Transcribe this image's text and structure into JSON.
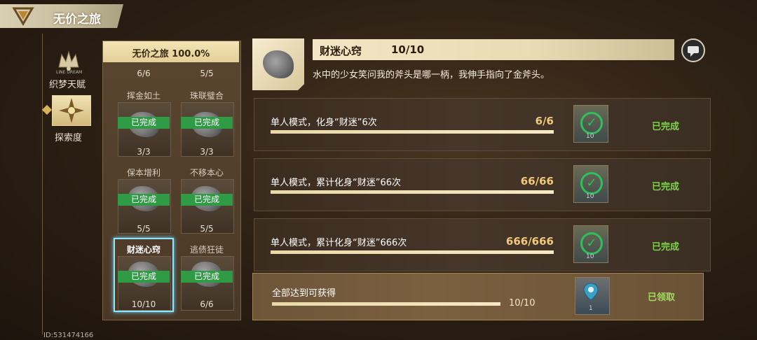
{
  "header": {
    "title": "无价之旅",
    "back_icon": "back-arrow-icon"
  },
  "sidebar": {
    "items": [
      {
        "label": "织梦天赋",
        "icon": "crown-icon",
        "sub": "LINE DREAM"
      },
      {
        "label": "探索度",
        "icon": "compass-star-icon",
        "selected": true
      }
    ],
    "user_id": "ID:531474166"
  },
  "list": {
    "header": "无价之旅 100.0%",
    "top_counts": [
      "6/6",
      "5/5"
    ],
    "cards": [
      {
        "title": "挥金如土",
        "status": "已完成",
        "count": "3/3"
      },
      {
        "title": "珠联璧合",
        "status": "已完成",
        "count": "3/3"
      },
      {
        "title": "保本增利",
        "status": "已完成",
        "count": "5/5"
      },
      {
        "title": "不移本心",
        "status": "已完成",
        "count": "5/5"
      },
      {
        "title": "财迷心窍",
        "status": "已完成",
        "count": "10/10"
      },
      {
        "title": "逃债狂徒",
        "status": "已完成",
        "count": "6/6"
      }
    ]
  },
  "detail": {
    "title": "财迷心窍",
    "progress": "10/10",
    "description": "水中的少女笑问我的斧头是哪一柄，我伸手指向了金斧头。",
    "chat_icon": "chat-bubble-icon"
  },
  "tasks": [
    {
      "label": "单人模式，化身“财迷”6次",
      "count": "6/6",
      "progress": 1.0,
      "reward_num": "10",
      "status": "已完成"
    },
    {
      "label": "单人模式，累计化身“财迷”66次",
      "count": "66/66",
      "progress": 1.0,
      "reward_num": "10",
      "status": "已完成"
    },
    {
      "label": "单人模式，累计化身“财迷”666次",
      "count": "666/666",
      "progress": 1.0,
      "reward_num": "10",
      "status": "已完成"
    }
  ],
  "summary": {
    "label": "全部达到可获得",
    "count": "10/10",
    "progress": 1.0,
    "reward_num": "1",
    "status": "已领取"
  },
  "colors": {
    "done_green": "#2f9b45",
    "accent_gold": "#f0c97a",
    "select_cyan": "#8fe6ff"
  }
}
